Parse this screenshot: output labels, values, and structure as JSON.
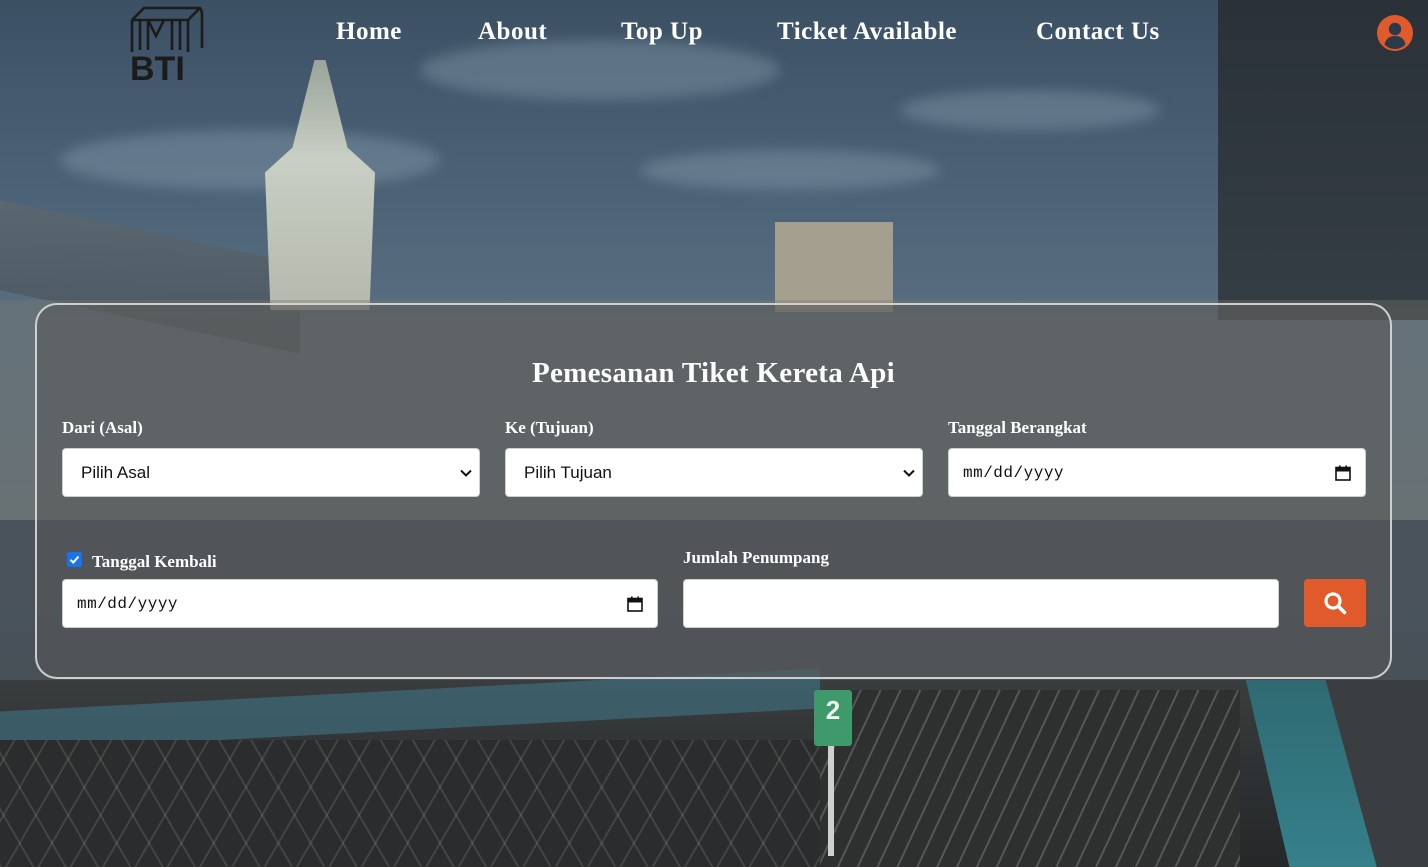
{
  "brand": {
    "logo_text": "BTI"
  },
  "nav": {
    "items": [
      {
        "label": "Home"
      },
      {
        "label": "About"
      },
      {
        "label": "Top Up"
      },
      {
        "label": "Ticket Available"
      },
      {
        "label": "Contact Us"
      }
    ]
  },
  "user_icon": "user-circle-icon",
  "booking": {
    "title": "Pemesanan Tiket Kereta Api",
    "origin": {
      "label": "Dari (Asal)",
      "value": "Pilih Asal"
    },
    "destination": {
      "label": "Ke (Tujuan)",
      "value": "Pilih Tujuan"
    },
    "departure": {
      "label": "Tanggal Berangkat",
      "value": "mm/dd/yyyy"
    },
    "return": {
      "label": "Tanggal Kembali",
      "checked": true,
      "value": "mm/dd/yyyy"
    },
    "passengers": {
      "label": "Jumlah Penumpang",
      "value": ""
    },
    "search_icon": "search-icon"
  },
  "colors": {
    "accent": "#e05a2c",
    "panel_border": "#dcdcdc",
    "checkbox": "#1a73e8"
  },
  "background": {
    "sign_text": "2"
  }
}
